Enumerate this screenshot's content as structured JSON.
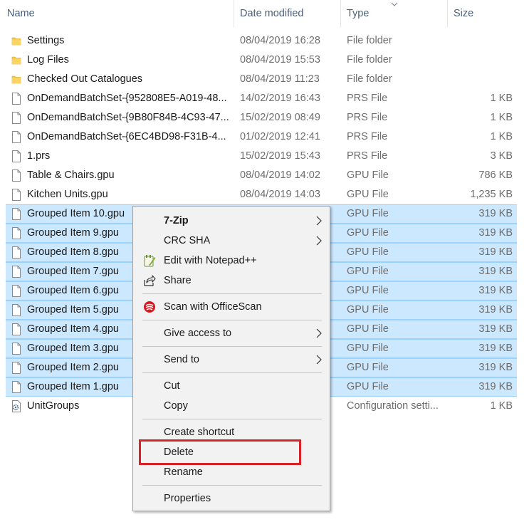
{
  "columns": {
    "name": "Name",
    "date": "Date modified",
    "type": "Type",
    "size": "Size"
  },
  "colors": {
    "folder": "#f8c843",
    "selection": "#cce8ff",
    "selection_border": "#99d1ff",
    "highlight": "#d92228"
  },
  "files": [
    {
      "name": "Settings",
      "date": "08/04/2019 16:28",
      "type": "File folder",
      "size": "",
      "icon": "folder-icon",
      "selected": false
    },
    {
      "name": "Log Files",
      "date": "08/04/2019 15:53",
      "type": "File folder",
      "size": "",
      "icon": "folder-icon",
      "selected": false
    },
    {
      "name": "Checked Out Catalogues",
      "date": "08/04/2019 11:23",
      "type": "File folder",
      "size": "",
      "icon": "folder-icon",
      "selected": false
    },
    {
      "name": "OnDemandBatchSet-{952808E5-A019-48...",
      "date": "14/02/2019 16:43",
      "type": "PRS File",
      "size": "1 KB",
      "icon": "file-icon",
      "selected": false
    },
    {
      "name": "OnDemandBatchSet-{9B80F84B-4C93-47...",
      "date": "15/02/2019 08:49",
      "type": "PRS File",
      "size": "1 KB",
      "icon": "file-icon",
      "selected": false
    },
    {
      "name": "OnDemandBatchSet-{6EC4BD98-F31B-4...",
      "date": "01/02/2019 12:41",
      "type": "PRS File",
      "size": "1 KB",
      "icon": "file-icon",
      "selected": false
    },
    {
      "name": "1.prs",
      "date": "15/02/2019 15:43",
      "type": "PRS File",
      "size": "3 KB",
      "icon": "file-icon",
      "selected": false
    },
    {
      "name": "Table & Chairs.gpu",
      "date": "08/04/2019 14:02",
      "type": "GPU File",
      "size": "786 KB",
      "icon": "file-icon",
      "selected": false
    },
    {
      "name": "Kitchen Units.gpu",
      "date": "08/04/2019 14:03",
      "type": "GPU File",
      "size": "1,235 KB",
      "icon": "file-icon",
      "selected": false
    },
    {
      "name": "Grouped Item 10.gpu",
      "date": "",
      "type": "GPU File",
      "size": "319 KB",
      "icon": "file-icon",
      "selected": true
    },
    {
      "name": "Grouped Item 9.gpu",
      "date": "",
      "type": "GPU File",
      "size": "319 KB",
      "icon": "file-icon",
      "selected": true
    },
    {
      "name": "Grouped Item 8.gpu",
      "date": "",
      "type": "GPU File",
      "size": "319 KB",
      "icon": "file-icon",
      "selected": true
    },
    {
      "name": "Grouped Item 7.gpu",
      "date": "",
      "type": "GPU File",
      "size": "319 KB",
      "icon": "file-icon",
      "selected": true
    },
    {
      "name": "Grouped Item 6.gpu",
      "date": "",
      "type": "GPU File",
      "size": "319 KB",
      "icon": "file-icon",
      "selected": true
    },
    {
      "name": "Grouped Item 5.gpu",
      "date": "",
      "type": "GPU File",
      "size": "319 KB",
      "icon": "file-icon",
      "selected": true
    },
    {
      "name": "Grouped Item 4.gpu",
      "date": "",
      "type": "GPU File",
      "size": "319 KB",
      "icon": "file-icon",
      "selected": true
    },
    {
      "name": "Grouped Item 3.gpu",
      "date": "",
      "type": "GPU File",
      "size": "319 KB",
      "icon": "file-icon",
      "selected": true
    },
    {
      "name": "Grouped Item 2.gpu",
      "date": "",
      "type": "GPU File",
      "size": "319 KB",
      "icon": "file-icon",
      "selected": true
    },
    {
      "name": "Grouped Item 1.gpu",
      "date": "",
      "type": "GPU File",
      "size": "319 KB",
      "icon": "file-icon",
      "selected": true
    },
    {
      "name": "UnitGroups",
      "date": "",
      "type": "Configuration setti...",
      "size": "1 KB",
      "icon": "settings-file-icon",
      "selected": false
    }
  ],
  "context_menu": {
    "items": [
      {
        "label": "7-Zip",
        "bold": true,
        "submenu": true,
        "icon": ""
      },
      {
        "label": "CRC SHA",
        "bold": false,
        "submenu": true,
        "icon": ""
      },
      {
        "label": "Edit with Notepad++",
        "bold": false,
        "submenu": false,
        "icon": "notepad-plus-plus-icon"
      },
      {
        "label": "Share",
        "bold": false,
        "submenu": false,
        "icon": "share-icon"
      },
      {
        "label": "Scan with OfficeScan",
        "bold": false,
        "submenu": false,
        "icon": "officescan-icon"
      },
      {
        "label": "Give access to",
        "bold": false,
        "submenu": true,
        "icon": ""
      },
      {
        "label": "Send to",
        "bold": false,
        "submenu": true,
        "icon": ""
      },
      {
        "label": "Cut",
        "bold": false,
        "submenu": false,
        "icon": ""
      },
      {
        "label": "Copy",
        "bold": false,
        "submenu": false,
        "icon": ""
      },
      {
        "label": "Create shortcut",
        "bold": false,
        "submenu": false,
        "icon": ""
      },
      {
        "label": "Delete",
        "bold": false,
        "submenu": false,
        "icon": "",
        "highlighted": true
      },
      {
        "label": "Rename",
        "bold": false,
        "submenu": false,
        "icon": ""
      },
      {
        "label": "Properties",
        "bold": false,
        "submenu": false,
        "icon": ""
      }
    ]
  }
}
